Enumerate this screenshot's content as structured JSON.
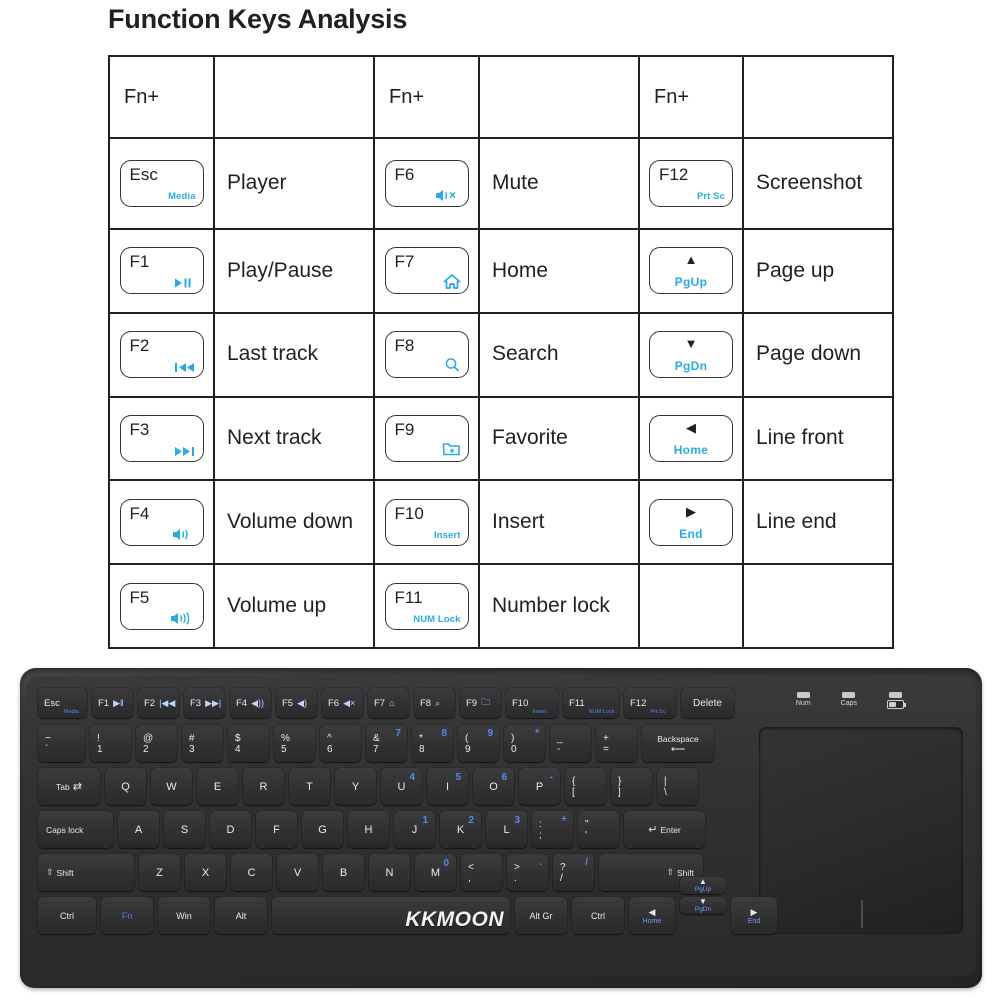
{
  "page_title": "Function Keys Analysis",
  "colors": {
    "accent_blue": "#29ABE2",
    "key_outline": "#3a3234",
    "text": "#231f20",
    "keyboard_blue": "#5b87e8"
  },
  "table": {
    "headers": [
      "Fn+",
      "",
      "Fn+",
      "",
      "Fn+",
      ""
    ],
    "rows": [
      {
        "c1": {
          "key": "Esc",
          "sub": "Media",
          "icon": "",
          "desc": "Player"
        },
        "c2": {
          "key": "F6",
          "sub": "",
          "icon": "mute-icon",
          "desc": "Mute"
        },
        "c3": {
          "key": "F12",
          "sub": "Prt Sc",
          "icon": "",
          "desc": "Screenshot",
          "centered": false
        }
      },
      {
        "c1": {
          "key": "F1",
          "sub": "",
          "icon": "play-pause-icon",
          "desc": "Play/Pause"
        },
        "c2": {
          "key": "F7",
          "sub": "",
          "icon": "home-house-icon",
          "desc": "Home"
        },
        "c3": {
          "key": "",
          "arrow": "▲",
          "sub": "PgUp",
          "desc": "Page up",
          "centered": true
        }
      },
      {
        "c1": {
          "key": "F2",
          "sub": "",
          "icon": "previous-track-icon",
          "desc": "Last track"
        },
        "c2": {
          "key": "F8",
          "sub": "",
          "icon": "search-icon",
          "desc": "Search"
        },
        "c3": {
          "key": "",
          "arrow": "▼",
          "sub": "PgDn",
          "desc": "Page down",
          "centered": true
        }
      },
      {
        "c1": {
          "key": "F3",
          "sub": "",
          "icon": "next-track-icon",
          "desc": "Next track"
        },
        "c2": {
          "key": "F9",
          "sub": "",
          "icon": "favorite-folder-icon",
          "desc": "Favorite"
        },
        "c3": {
          "key": "",
          "arrow": "◀",
          "sub": "Home",
          "desc": "Line front",
          "centered": true
        }
      },
      {
        "c1": {
          "key": "F4",
          "sub": "",
          "icon": "volume-down-icon",
          "desc": "Volume down"
        },
        "c2": {
          "key": "F10",
          "sub": "Insert",
          "icon": "",
          "desc": "Insert"
        },
        "c3": {
          "key": "",
          "arrow": "▶",
          "sub": "End",
          "desc": "Line end",
          "centered": true
        }
      },
      {
        "c1": {
          "key": "F5",
          "sub": "",
          "icon": "volume-up-icon",
          "desc": "Volume up"
        },
        "c2": {
          "key": "F11",
          "sub": "NUM Lock",
          "icon": "",
          "desc": "Number lock"
        },
        "c3": {
          "key": "",
          "arrow": "",
          "sub": "",
          "desc": "",
          "centered": false
        }
      }
    ]
  },
  "keyboard": {
    "brand": "KKMOON",
    "indicators": [
      {
        "label": "Num",
        "icon": "led-bar-icon"
      },
      {
        "label": "Caps",
        "icon": "led-bar-icon"
      },
      {
        "label": "",
        "icon": "battery-icon"
      }
    ],
    "function_row": [
      {
        "main": "Esc",
        "sub": "Media",
        "icon": ""
      },
      {
        "main": "F1",
        "sub": "",
        "icon": "▶‖"
      },
      {
        "main": "F2",
        "sub": "",
        "icon": "|◀◀"
      },
      {
        "main": "F3",
        "sub": "",
        "icon": "▶▶|"
      },
      {
        "main": "F4",
        "sub": "",
        "icon": "◀))"
      },
      {
        "main": "F5",
        "sub": "",
        "icon": "◀)"
      },
      {
        "main": "F6",
        "sub": "",
        "icon": "◀×"
      },
      {
        "main": "F7",
        "sub": "",
        "icon": "⌂"
      },
      {
        "main": "F8",
        "sub": "",
        "icon": "⌕"
      },
      {
        "main": "F9",
        "sub": "",
        "icon": "🗀"
      },
      {
        "main": "F10",
        "sub": "Insert",
        "icon": ""
      },
      {
        "main": "F11",
        "sub": "NUM Lock",
        "icon": ""
      },
      {
        "main": "F12",
        "sub": "Prt Sc",
        "icon": ""
      },
      {
        "main": "Delete",
        "sub": "",
        "icon": ""
      }
    ],
    "number_row": [
      {
        "up": "~",
        "dn": "`",
        "np": ""
      },
      {
        "up": "!",
        "dn": "1",
        "np": ""
      },
      {
        "up": "@",
        "dn": "2",
        "np": ""
      },
      {
        "up": "#",
        "dn": "3",
        "np": ""
      },
      {
        "up": "$",
        "dn": "4",
        "np": ""
      },
      {
        "up": "%",
        "dn": "5",
        "np": ""
      },
      {
        "up": "^",
        "dn": "6",
        "np": ""
      },
      {
        "up": "&",
        "dn": "7",
        "np": "7"
      },
      {
        "up": "*",
        "dn": "8",
        "np": "8"
      },
      {
        "up": "(",
        "dn": "9",
        "np": "9"
      },
      {
        "up": ")",
        "dn": "0",
        "np": "*"
      },
      {
        "up": "_",
        "dn": "-",
        "np": ""
      },
      {
        "up": "+",
        "dn": "=",
        "np": ""
      }
    ],
    "backspace_label": "Backspace",
    "tab_label": "Tab",
    "qwerty_row": [
      {
        "main": "Q",
        "np": ""
      },
      {
        "main": "W",
        "np": ""
      },
      {
        "main": "E",
        "np": ""
      },
      {
        "main": "R",
        "np": ""
      },
      {
        "main": "T",
        "np": ""
      },
      {
        "main": "Y",
        "np": ""
      },
      {
        "main": "U",
        "np": "4"
      },
      {
        "main": "I",
        "np": "5"
      },
      {
        "main": "O",
        "np": "6"
      },
      {
        "main": "P",
        "np": "-"
      },
      {
        "up": "{",
        "dn": "[",
        "np": ""
      },
      {
        "up": "}",
        "dn": "]",
        "np": ""
      },
      {
        "up": "|",
        "dn": "\\",
        "np": ""
      }
    ],
    "caps_label": "Caps lock",
    "home_row": [
      {
        "main": "A",
        "np": ""
      },
      {
        "main": "S",
        "np": ""
      },
      {
        "main": "D",
        "np": ""
      },
      {
        "main": "F",
        "np": ""
      },
      {
        "main": "G",
        "np": ""
      },
      {
        "main": "H",
        "np": ""
      },
      {
        "main": "J",
        "np": "1"
      },
      {
        "main": "K",
        "np": "2"
      },
      {
        "main": "L",
        "np": "3"
      },
      {
        "up": ":",
        "dn": ";",
        "np": "+"
      },
      {
        "up": "\"",
        "dn": "'",
        "np": ""
      }
    ],
    "enter_label": "Enter",
    "shift_label": "Shift",
    "bottom_letters_row": [
      {
        "main": "Z",
        "np": ""
      },
      {
        "main": "X",
        "np": ""
      },
      {
        "main": "C",
        "np": ""
      },
      {
        "main": "V",
        "np": ""
      },
      {
        "main": "B",
        "np": ""
      },
      {
        "main": "N",
        "np": ""
      },
      {
        "main": "M",
        "np": "0"
      },
      {
        "up": "<",
        "dn": ",",
        "np": ""
      },
      {
        "up": ">",
        "dn": ".",
        "np": "."
      },
      {
        "up": "?",
        "dn": "/",
        "np": "/"
      }
    ],
    "modifier_row": {
      "ctrl_left": "Ctrl",
      "fn": "Fn",
      "win": "Win",
      "alt": "Alt",
      "space": "",
      "alt_gr": "Alt Gr",
      "ctrl_right": "Ctrl"
    },
    "arrow_cluster": [
      {
        "arrow": "▲",
        "sub": "PgUp"
      },
      {
        "arrow": "▼",
        "sub": "PgDn"
      },
      {
        "arrow": "◀",
        "sub": "Home"
      },
      {
        "arrow": "▶",
        "sub": "End"
      }
    ]
  }
}
